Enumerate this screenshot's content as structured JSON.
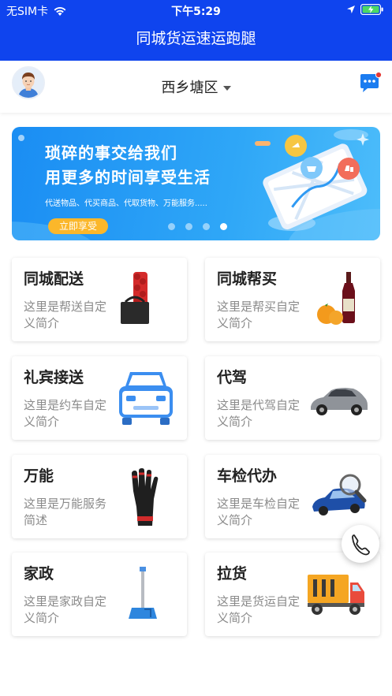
{
  "status_bar": {
    "carrier": "无SIM卡",
    "time": "下午5:29"
  },
  "nav": {
    "title": "同城货运速运跑腿"
  },
  "header": {
    "location": "西乡塘区"
  },
  "banner": {
    "headline_1": "琐碎的事交给我们",
    "headline_2": "用更多的时间享受生活",
    "subtitle": "代送物品、代买商品、代取货物、万能服务.....",
    "cta": "立即享受",
    "slide_count": 4,
    "active_slide": 4
  },
  "services": [
    {
      "title": "同城配送",
      "desc": "这里是帮送自定义简介",
      "icon": "handbag-roses-icon"
    },
    {
      "title": "同城帮买",
      "desc": "这里是帮买自定义简介",
      "icon": "wine-oranges-icon"
    },
    {
      "title": "礼宾接送",
      "desc": "这里是约车自定义简介",
      "icon": "car-front-icon"
    },
    {
      "title": "代驾",
      "desc": "这里是代驾自定义简介",
      "icon": "sedan-icon"
    },
    {
      "title": "万能",
      "desc": "这里是万能服务简述",
      "icon": "glove-icon"
    },
    {
      "title": "车检代办",
      "desc": "这里是车检自定义简介",
      "icon": "car-inspection-icon"
    },
    {
      "title": "家政",
      "desc": "这里是家政自定义简介",
      "icon": "broom-icon"
    },
    {
      "title": "拉货",
      "desc": "这里是货运自定义简介",
      "icon": "truck-icon"
    }
  ],
  "colors": {
    "brand_blue": "#0f44ee",
    "card_title": "#222222",
    "card_desc": "#8a8a8a",
    "cta_orange": "#fbb72a",
    "badge_red": "#e53935"
  }
}
